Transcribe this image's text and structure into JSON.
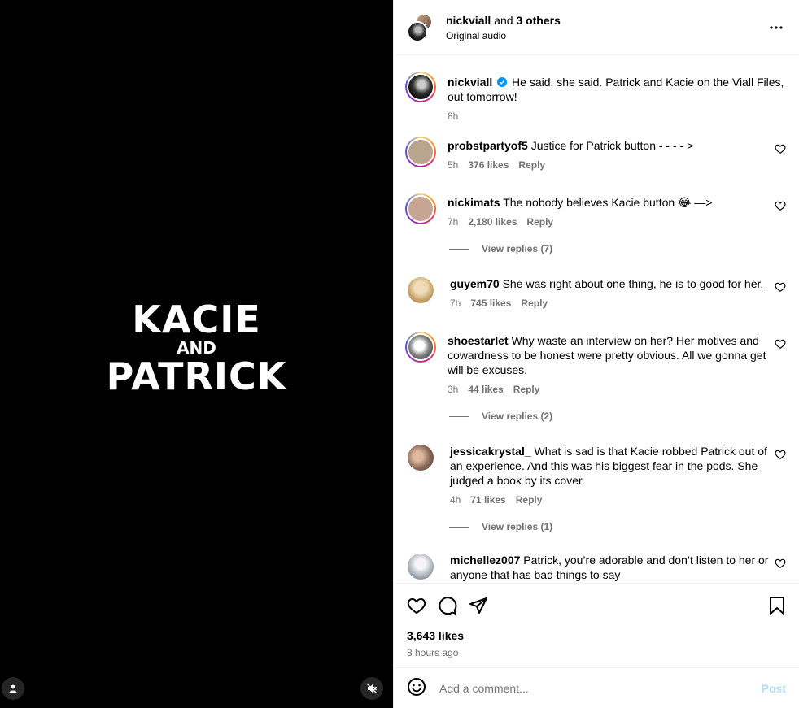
{
  "media": {
    "title_line1": "KACIE",
    "title_line2": "AND",
    "title_line3": "PATRICK",
    "left_button_icon": "user-icon",
    "right_button_icon": "muted-speaker-icon"
  },
  "header": {
    "username": "nickviall",
    "and_text": "and",
    "others": "3 others",
    "subtitle": "Original audio",
    "more_icon": "more-options-icon"
  },
  "caption": {
    "username": "nickviall",
    "verified": true,
    "text": "He said, she said. Patrick and Kacie on the Viall Files, out tomorrow!",
    "time": "8h"
  },
  "comments": [
    {
      "username": "probstpartyof5",
      "text": "Justice for Patrick button - - - - >",
      "time": "5h",
      "likes": "376 likes",
      "reply": "Reply",
      "story_ring": true,
      "avatar_color": "#b9a48e"
    },
    {
      "username": "nickimats",
      "text": "The nobody believes Kacie button 😂 —>",
      "time": "7h",
      "likes": "2,180 likes",
      "reply": "Reply",
      "story_ring": true,
      "avatar_color": "#c7a594",
      "view_replies": "View replies (7)"
    },
    {
      "username": "guyem70",
      "text": "She was right about one thing, he is to good for her.",
      "time": "7h",
      "likes": "745 likes",
      "reply": "Reply",
      "story_ring": false,
      "avatar_color": "#d8c29a"
    },
    {
      "username": "shoestarlet",
      "text": "Why waste an interview on her? Her motives and cowardness to be honest were pretty obvious. All we gonna get will be excuses.",
      "time": "3h",
      "likes": "44 likes",
      "reply": "Reply",
      "story_ring": true,
      "avatar_color": "#8f8f8f",
      "view_replies": "View replies (2)"
    },
    {
      "username": "jessicakrystal_",
      "text": "What is sad is that Kacie robbed Patrick out of an experience. And this was his biggest fear in the pods. She judged a book by its cover.",
      "time": "4h",
      "likes": "71 likes",
      "reply": "Reply",
      "story_ring": false,
      "avatar_color": "#8c6a5a",
      "view_replies": "View replies (1)"
    },
    {
      "username": "michellez007",
      "text": "Patrick, you’re adorable and don’t listen to her or anyone that has bad things to say",
      "time": "",
      "likes": "",
      "reply": "",
      "story_ring": false,
      "avatar_color": "#a9b1bb"
    }
  ],
  "actions": {
    "like_icon": "heart-icon",
    "comment_icon": "comment-icon",
    "share_icon": "share-icon",
    "save_icon": "bookmark-icon",
    "likes_count": "3,643 likes",
    "time_ago": "8 hours ago"
  },
  "add_comment": {
    "emoji_icon": "emoji-icon",
    "placeholder": "Add a comment...",
    "post_label": "Post"
  },
  "colors": {
    "link_post": "#b2dffc",
    "secondary_text": "#737373",
    "verified": "#0095f6"
  }
}
